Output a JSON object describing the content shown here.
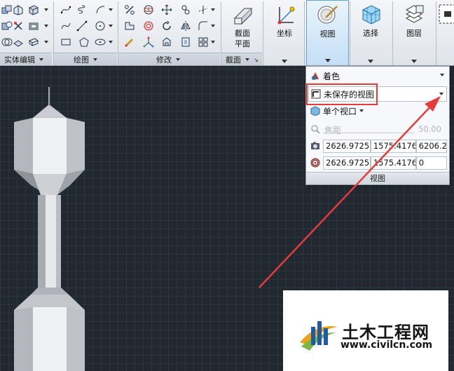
{
  "ribbon": {
    "groups": {
      "solid_edit": "实体编辑",
      "draw": "绘图",
      "modify": "修改",
      "section": "截面"
    },
    "buttons": {
      "section_plane_line1": "截面",
      "section_plane_line2": "平面",
      "coordinates": "坐标",
      "view": "视图",
      "selection": "选择",
      "layers": "图层"
    }
  },
  "view_panel": {
    "visual_style": "着色",
    "named_view": "未保存的视图",
    "viewport_config": "单个视口",
    "focal_length_label": "焦距",
    "focal_length_value": "50.00",
    "camera_position": [
      "2626.9725",
      "1575.4176",
      "6206.24"
    ],
    "target_position": [
      "2626.9725",
      "1575.4176",
      "0"
    ],
    "footer": "视图"
  },
  "watermark": {
    "title": "土木工程网",
    "url": "www.civilcn.com"
  },
  "colors": {
    "canvas_bg": "#212830",
    "highlight": "#e53b3b",
    "ribbon_active": "#c4def5"
  }
}
